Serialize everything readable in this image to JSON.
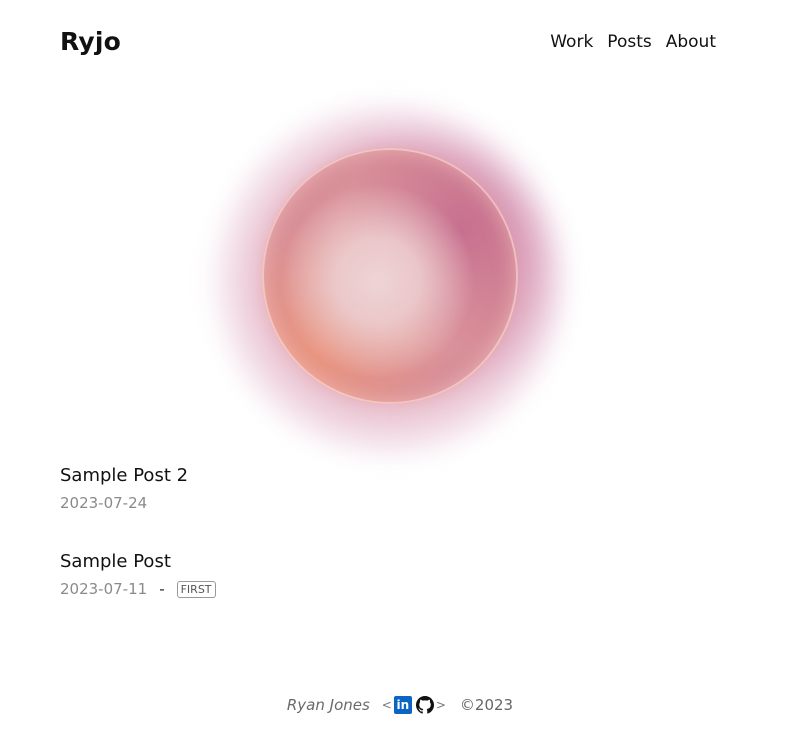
{
  "header": {
    "brand": "Ryjo",
    "nav": [
      {
        "label": "Work"
      },
      {
        "label": "Posts"
      },
      {
        "label": "About"
      }
    ]
  },
  "posts": [
    {
      "title": "Sample Post 2",
      "date": "2023-07-24"
    },
    {
      "title": "Sample Post",
      "date": "2023-07-11",
      "separator": "-",
      "tag": "FIRST"
    }
  ],
  "footer": {
    "author": "Ryan Jones",
    "bracket_open": "<",
    "bracket_close": ">",
    "linkedin_icon_text": "in",
    "copyright": "©2023",
    "icons": [
      "linkedin-icon",
      "github-icon"
    ]
  },
  "colors": {
    "linkedin": "#0a66c2",
    "text": "#111111",
    "muted": "#8a8a8a"
  }
}
